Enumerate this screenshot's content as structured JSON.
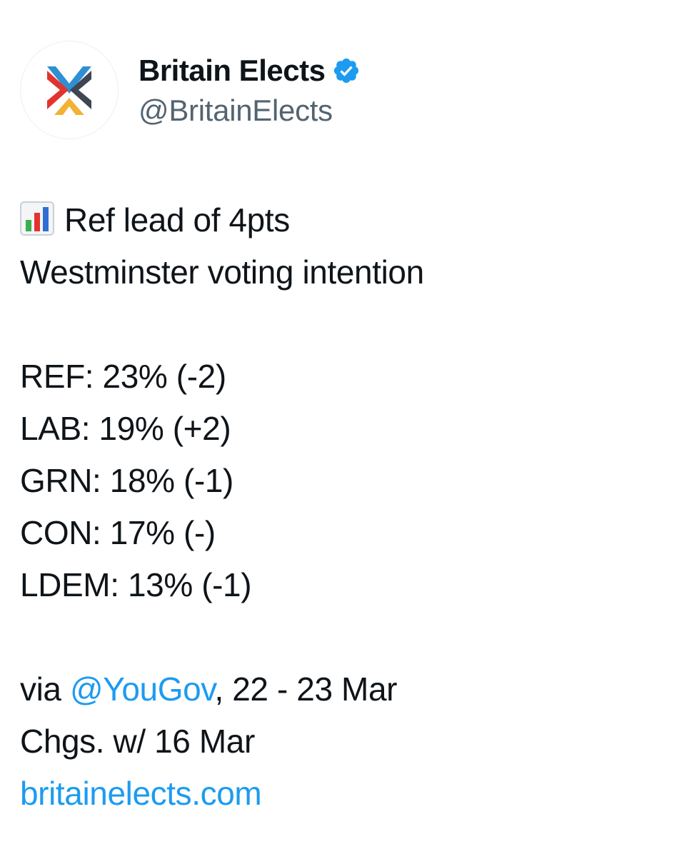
{
  "account": {
    "display_name": "Britain Elects",
    "handle": "@BritainElects",
    "verified": true,
    "avatar_icon": "britain-elects-logo",
    "verified_icon": "verified-badge-icon",
    "verified_color": "#1d9bf0"
  },
  "post": {
    "headline_icon": "bar-chart-emoji-icon",
    "headline": "Ref lead of 4pts",
    "subtitle": "Westminster voting intention",
    "results": [
      {
        "text": "REF: 23% (-2)"
      },
      {
        "text": "LAB: 19% (+2)"
      },
      {
        "text": "GRN: 18% (-1)"
      },
      {
        "text": "CON: 17% (-)"
      },
      {
        "text": "LDEM: 13% (-1)"
      }
    ],
    "source_prefix": "via ",
    "source_mention": "@YouGov",
    "source_suffix": ", 22 - 23 Mar",
    "changes_note": "Chgs. w/ 16 Mar",
    "website_link": "britainelects.com",
    "link_color": "#1d9bf0"
  }
}
